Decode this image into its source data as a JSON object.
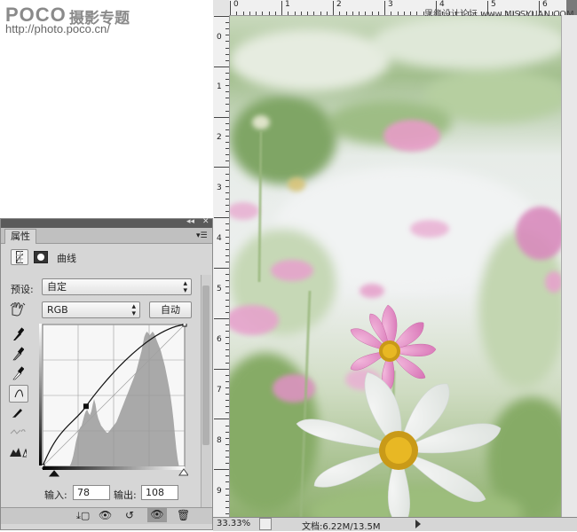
{
  "watermark": {
    "logo": "POCO",
    "logo_cn": "摄影专题",
    "url": "http://photo.poco.cn/",
    "site": "思缘设计论坛 www.MISSYUAN.COM"
  },
  "rulers": {
    "top": [
      "0",
      "1",
      "2",
      "3",
      "4",
      "5",
      "6"
    ],
    "left": [
      "0",
      "1",
      "2",
      "3",
      "4",
      "5",
      "6",
      "7",
      "8",
      "9"
    ]
  },
  "status": {
    "zoom": "33.33%",
    "doc": "文档:6.22M/13.5M"
  },
  "panel": {
    "tab": "属性",
    "adjustment_name": "曲线",
    "preset_label": "预设:",
    "preset_value": "自定",
    "channel_value": "RGB",
    "auto_button": "自动",
    "input_label": "输入:",
    "input_value": "78",
    "output_label": "输出:",
    "output_value": "108"
  },
  "curve": {
    "points": [
      [
        0,
        0
      ],
      [
        78,
        108
      ],
      [
        255,
        255
      ]
    ]
  }
}
